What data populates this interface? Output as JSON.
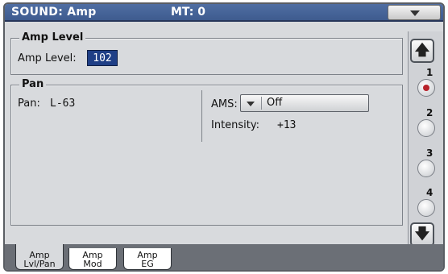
{
  "title_bar": {
    "title": "SOUND: Amp",
    "mt": "MT: 0"
  },
  "amp_level_group": {
    "title": "Amp Level",
    "label": "Amp Level:",
    "value": "102"
  },
  "pan_group": {
    "title": "Pan",
    "pan_label": "Pan:",
    "pan_value": "L-63",
    "ams_label": "AMS:",
    "ams_value": "Off",
    "intensity_label": "Intensity:",
    "intensity_value": "+13"
  },
  "scroll": {
    "up_label": "🡅",
    "down_label": "🡇",
    "pages": [
      "1",
      "2",
      "3",
      "4"
    ],
    "active_page": 1
  },
  "tabs": [
    {
      "line1": "Amp",
      "line2": "Lvl/Pan",
      "active": true
    },
    {
      "line1": "Amp",
      "line2": "Mod",
      "active": false
    },
    {
      "line1": "Amp",
      "line2": "EG",
      "active": false
    }
  ]
}
